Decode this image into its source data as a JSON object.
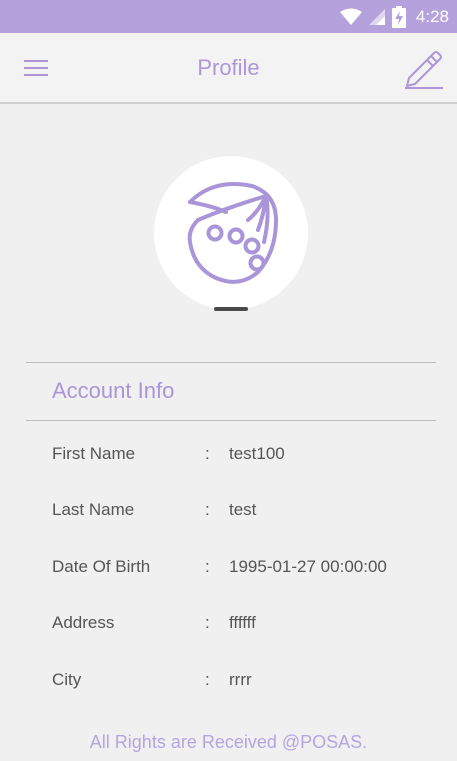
{
  "status_bar": {
    "time": "4:28",
    "icons": [
      "wifi-icon",
      "signal-icon",
      "battery-charging-icon"
    ]
  },
  "app_bar": {
    "title": "Profile",
    "menu_icon": "menu-icon",
    "edit_icon": "edit-pencil-icon"
  },
  "colors": {
    "status_bar": "#b5a2dc",
    "accent": "#ad97d8",
    "background": "#f0f0f0",
    "footer": "#b3a5e0"
  },
  "avatar": {
    "icon": "logo-icon"
  },
  "account_info": {
    "title": "Account Info",
    "rows": [
      {
        "label": "First Name",
        "separator": ":",
        "value": "test100"
      },
      {
        "label": "Last Name",
        "separator": ":",
        "value": "test"
      },
      {
        "label": "Date Of Birth",
        "separator": ":",
        "value": "1995-01-27 00:00:00"
      },
      {
        "label": "Address",
        "separator": ":",
        "value": "ffffff"
      },
      {
        "label": "City",
        "separator": ":",
        "value": "rrrr"
      }
    ]
  },
  "footer": {
    "text": "All Rights are Received @POSAS."
  }
}
